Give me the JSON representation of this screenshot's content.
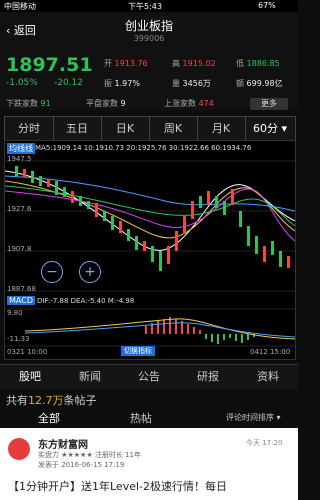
{
  "status": {
    "carrier": "中国移动",
    "time": "下午5:43",
    "battery": "67%"
  },
  "nav": {
    "back": "返回",
    "title": "创业板指",
    "code": "399006"
  },
  "quote": {
    "price": "1897.51",
    "change_pct": "-1.05%",
    "change": "-20.12",
    "open_label": "开",
    "open": "1913.76",
    "high_label": "高",
    "high": "1915.02",
    "low_label": "低",
    "low": "1886.85",
    "amp_label": "振",
    "amp": "1.97%",
    "vol_label": "量",
    "vol": "3456万",
    "amount_label": "额",
    "amount": "699.98亿",
    "down_label": "下跌家数",
    "down": "91",
    "flat_label": "平盘家数",
    "flat": "9",
    "up_label": "上涨家数",
    "up": "474",
    "more": "更多"
  },
  "period_tabs": [
    "分时",
    "五日",
    "日K",
    "周K",
    "月K",
    "60分"
  ],
  "chart": {
    "ma_tag": "均线线",
    "ma_text": "MA5:1909.14  10:1910.73  20:1925.76  30:1922.66  60:1934.76",
    "y_top": "1947.5",
    "y_mid1": "1927.6",
    "y_mid2": "1907.8",
    "y_bottom": "1887.68",
    "macd_tag": "MACD",
    "macd_text": "DIF:-7.88  DEA:-5.40  M:-4.98",
    "macd_top": "9.80",
    "macd_bottom": "-11.33",
    "left_time": "0321 10:00",
    "right_time": "0412 15:00",
    "switch_label": "切换指标",
    "zoom_out": "−",
    "zoom_in": "+"
  },
  "info_tabs": [
    "股吧",
    "新闻",
    "公告",
    "研报",
    "资料"
  ],
  "posts": {
    "prefix": "共有",
    "count": "12.7万",
    "suffix": "条帖子"
  },
  "sub_tabs": {
    "all": "全部",
    "hot": "热帖",
    "sort": "评论时间排序"
  },
  "feed": {
    "name": "东方财富网",
    "meta": "实盘力 ★★★★★ 注册时长 11年",
    "date": "发表于 2016-06-15 17:19",
    "time": "今天 17:20",
    "title": "【1分钟开户】送1年Level-2极速行情！每日"
  }
}
